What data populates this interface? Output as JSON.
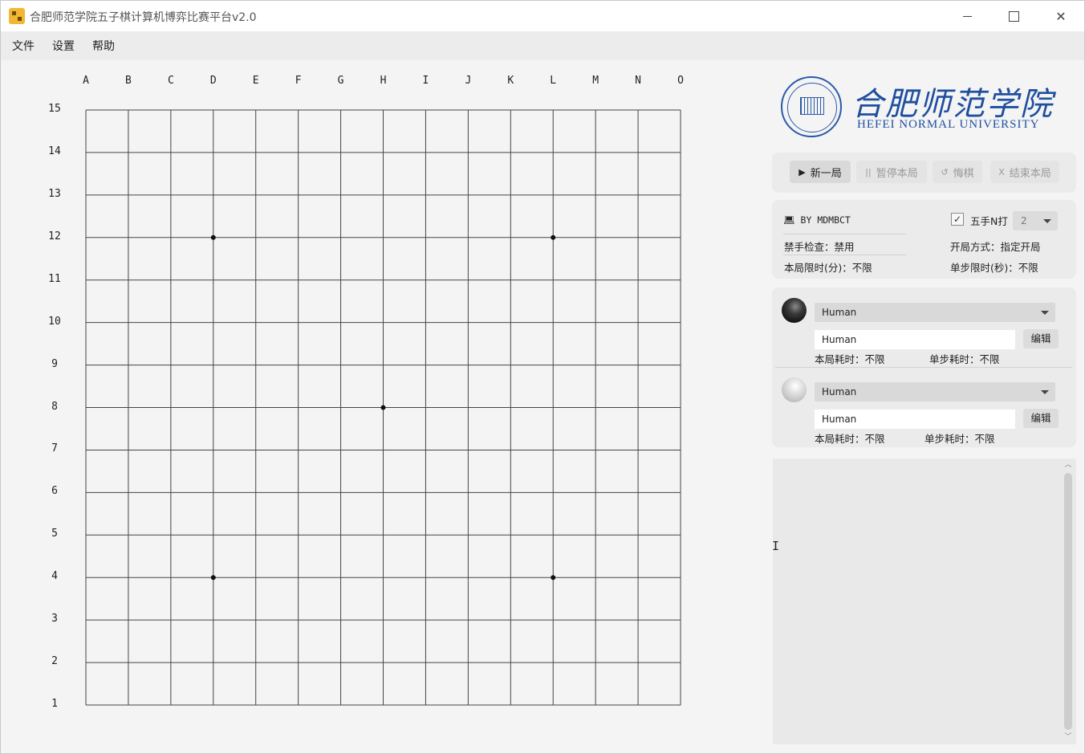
{
  "window": {
    "title": "合肥师范学院五子棋计算机博弈比赛平台v2.0",
    "minimize_icon": "minimize-icon",
    "maximize_icon": "maximize-icon",
    "close_label": "✕"
  },
  "menu": [
    "文件",
    "设置",
    "帮助"
  ],
  "board": {
    "columns": [
      "A",
      "B",
      "C",
      "D",
      "E",
      "F",
      "G",
      "H",
      "I",
      "J",
      "K",
      "L",
      "M",
      "N",
      "O"
    ],
    "rows": [
      "15",
      "14",
      "13",
      "12",
      "11",
      "10",
      "9",
      "8",
      "7",
      "6",
      "5",
      "4",
      "3",
      "2",
      "1"
    ],
    "star_points": [
      [
        "D",
        "12"
      ],
      [
        "L",
        "12"
      ],
      [
        "H",
        "8"
      ],
      [
        "D",
        "4"
      ],
      [
        "L",
        "4"
      ]
    ],
    "line_color": "#444444",
    "background": "#f4f4f4"
  },
  "logo": {
    "cn": "合肥师范学院",
    "en": "HEFEI NORMAL UNIVERSITY",
    "color": "#1f4f9e"
  },
  "controls": {
    "new_game": {
      "icon": "▶",
      "label": "新一局"
    },
    "pause": {
      "icon": "||",
      "label": "暂停本局"
    },
    "undo": {
      "icon": "↺",
      "label": "悔棋"
    },
    "end": {
      "icon": "X",
      "label": "结束本局"
    }
  },
  "info": {
    "author": "BY MDMBCT",
    "forbidden_check": "禁手检查：禁用",
    "total_limit": "本局限时(分)：不限",
    "fifth_move_label": "五手N打",
    "fifth_move_checked": "✓",
    "n_value": "2",
    "opening_mode": "开局方式：指定开局",
    "step_limit": "单步限时(秒)：不限"
  },
  "players": {
    "black": {
      "type": "Human",
      "name": "Human",
      "edit": "编辑",
      "total_time": "本局耗时：不限",
      "step_time": "单步耗时：不限"
    },
    "white": {
      "type": "Human",
      "name": "Human",
      "edit": "编辑",
      "total_time": "本局耗时：不限",
      "step_time": "单步耗时：不限"
    }
  },
  "scroll": {
    "up": "︿",
    "down": "﹀"
  },
  "cursor": "I"
}
